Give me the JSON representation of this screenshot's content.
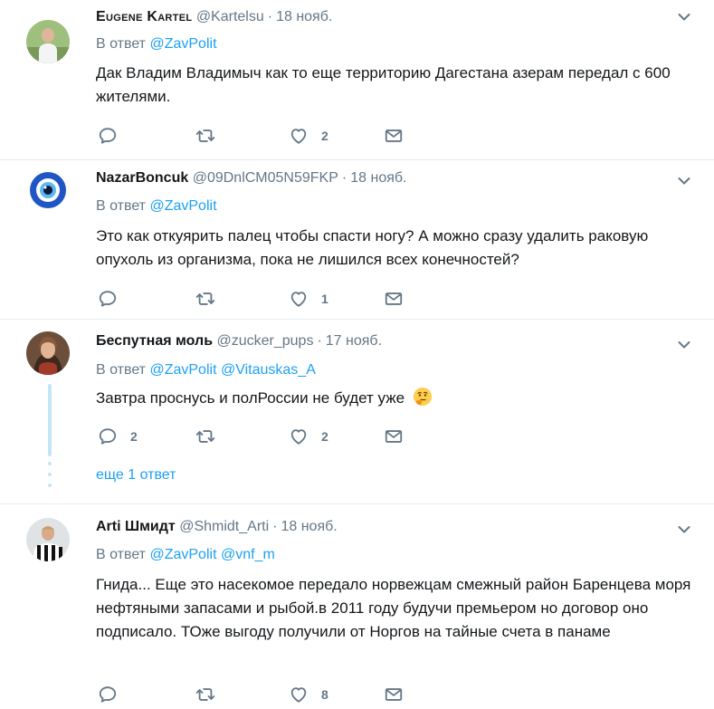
{
  "tweets": [
    {
      "name": "Eugene Kartel",
      "handle": "@Kartelsu",
      "time": "18 нояб.",
      "reply_prefix": "В ответ",
      "reply_to": [
        "@ZavPolit"
      ],
      "text": "Дак Владим Владимыч как то еще территорию Дагестана азерам передал с 600 жителями.",
      "replies": "",
      "retweets": "",
      "likes": "2"
    },
    {
      "name": "NazarBoncuk",
      "handle": "@09DnlCM05N59FKP",
      "time": "18 нояб.",
      "reply_prefix": "В ответ",
      "reply_to": [
        "@ZavPolit"
      ],
      "text": "Это как откуярить палец чтобы спасти ногу? А можно сразу удалить раковую опухоль из организма, пока не лишился всех конечностей?",
      "replies": "",
      "retweets": "",
      "likes": "1"
    },
    {
      "name": "Беспутная моль",
      "handle": "@zucker_pups",
      "time": "17 нояб.",
      "reply_prefix": "В ответ",
      "reply_to": [
        "@ZavPolit",
        "@Vitauskas_A"
      ],
      "text": "Завтра проснусь и полРоссии не будет уже",
      "emoji": "thinking-face-emoji",
      "replies": "2",
      "retweets": "",
      "likes": "2",
      "more_replies": "еще 1 ответ"
    },
    {
      "name": "Arti Шмидт",
      "handle": "@Shmidt_Arti",
      "time": "18 нояб.",
      "reply_prefix": "В ответ",
      "reply_to": [
        "@ZavPolit",
        "@vnf_m"
      ],
      "text": "Гнида... Еще это насекомое передало норвежцам смежный район Баренцева моря нефтяными запасами и рыбой.в 2011 году будучи премьером но договор оно подписало. ТОже выгоду получили от Норгов на тайные счета в панаме",
      "replies": "",
      "retweets": "",
      "likes": "8"
    }
  ],
  "icons": {
    "reply": "reply-icon",
    "retweet": "retweet-icon",
    "like": "heart-icon",
    "dm": "envelope-icon",
    "caret": "chevron-down-icon"
  },
  "colors": {
    "link": "#1da1f2",
    "muted": "#657786",
    "text": "#14171a",
    "thread": "#c4e5f8",
    "divider": "#e6ecf0"
  }
}
